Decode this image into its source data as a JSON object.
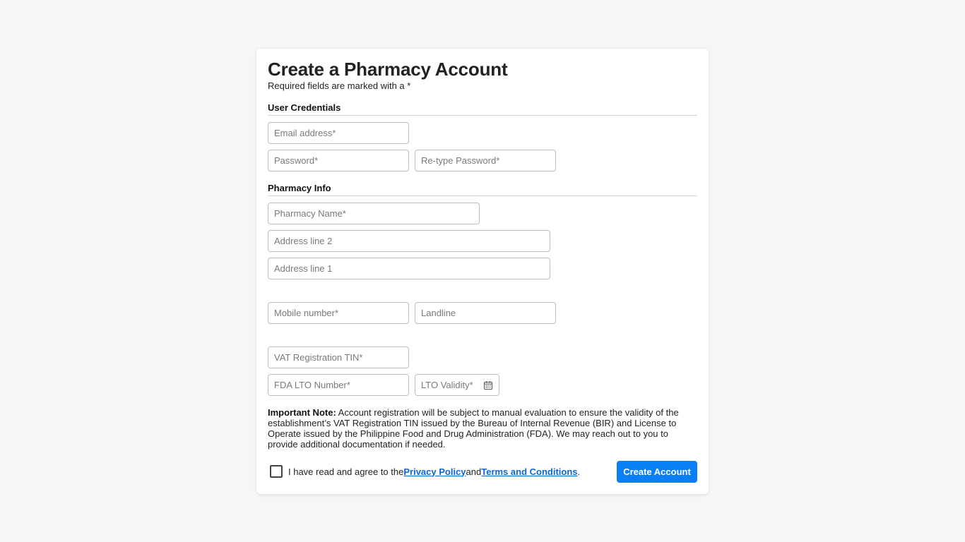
{
  "header": {
    "title": "Create a Pharmacy Account",
    "subtitle": "Required fields are marked with a *"
  },
  "sections": {
    "credentials": "User Credentials",
    "pharmacy": "Pharmacy Info"
  },
  "fields": {
    "email": {
      "placeholder": "Email address*",
      "value": ""
    },
    "password": {
      "placeholder": "Password*",
      "value": ""
    },
    "retype_password": {
      "placeholder": "Re-type Password*",
      "value": ""
    },
    "pharmacy_name": {
      "placeholder": "Pharmacy Name*",
      "value": ""
    },
    "address_line_2": {
      "placeholder": "Address line 2",
      "value": ""
    },
    "address_line_1": {
      "placeholder": "Address line 1",
      "value": ""
    },
    "mobile": {
      "placeholder": "Mobile number*",
      "value": ""
    },
    "landline": {
      "placeholder": "Landline",
      "value": ""
    },
    "vat_tin": {
      "placeholder": "VAT Registration TIN*",
      "value": ""
    },
    "fda_lto": {
      "placeholder": "FDA LTO Number*",
      "value": ""
    },
    "lto_validity": {
      "placeholder": "LTO Validity*",
      "value": "",
      "icon": "calendar-icon"
    }
  },
  "note": {
    "label": "Important Note:",
    "text": " Account registration will be subject to manual evaluation to ensure the validity of the establishment’s VAT Registration TIN issued by the Bureau of Internal Revenue (BIR) and License to Operate issued by the Philippine Food and Drug Administration (FDA). We may reach out to you to provide additional documentation if needed."
  },
  "agreement": {
    "prefix": "I have read and agree to the ",
    "privacy_link": "Privacy Policy",
    "middle": " and ",
    "terms_link": "Terms and Conditions",
    "suffix": ".",
    "checked": false
  },
  "actions": {
    "submit_label": "Create Account"
  },
  "colors": {
    "primary": "#0a7ff5",
    "link": "#0a66d6",
    "background": "#f6f6f6"
  }
}
